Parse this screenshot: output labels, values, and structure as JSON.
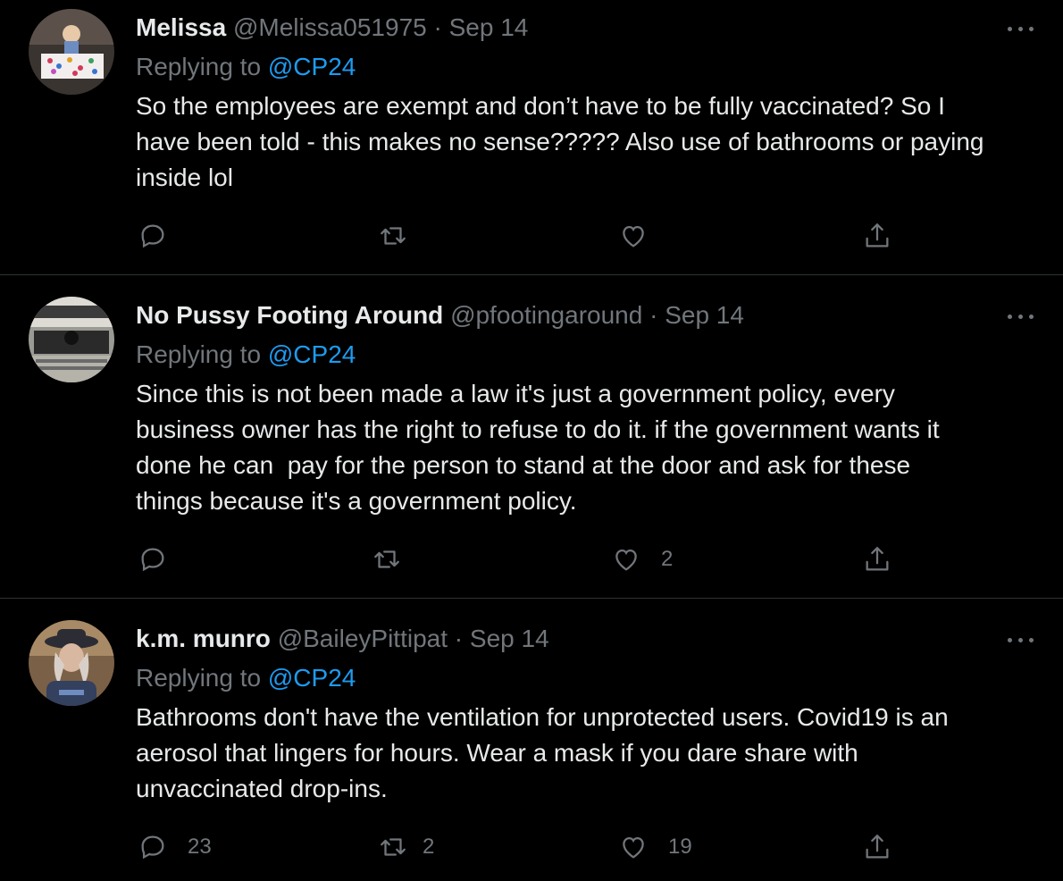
{
  "tweets": [
    {
      "name": "Melissa",
      "handle": "@Melissa051975",
      "dot": "·",
      "date": "Sep 14",
      "replying_prefix": "Replying to",
      "replying_handle": "@CP24",
      "text": "So the employees are exempt and don’t have to be fully vaccinated? So I\nhave been told - this makes no sense????? Also use of bathrooms or paying\ninside lol",
      "replies": "",
      "retweets": "",
      "likes": "",
      "icons": [
        "reply-icon",
        "retweet-icon",
        "like-icon",
        "share-icon"
      ]
    },
    {
      "name": "No Pussy Footing Around",
      "handle": "@pfootingaround",
      "dot": "·",
      "date": "Sep 14",
      "replying_prefix": "Replying to",
      "replying_handle": "@CP24",
      "text": "Since this is not been made a law it's just a government policy, every\nbusiness owner has the right to refuse to do it. if the government wants it\ndone he can  pay for the person to stand at the door and ask for these\nthings because it's a government policy.",
      "replies": "",
      "retweets": "",
      "likes": "2",
      "icons": [
        "reply-icon",
        "retweet-icon",
        "like-icon",
        "share-icon"
      ]
    },
    {
      "name": "k.m. munro",
      "handle": "@BaileyPittipat",
      "dot": "·",
      "date": "Sep 14",
      "replying_prefix": "Replying to",
      "replying_handle": "@CP24",
      "text": "Bathrooms don't have the ventilation for unprotected users. Covid19 is an\naerosol that lingers for hours. Wear a mask if you dare share with\nunvaccinated drop-ins.",
      "replies": "23",
      "retweets": "2",
      "likes": "19",
      "icons": [
        "reply-icon",
        "retweet-icon",
        "like-icon",
        "share-icon"
      ]
    }
  ],
  "colors": {
    "background": "#000000",
    "text": "#e7e9ea",
    "muted": "#71767b",
    "link": "#1d9bf0",
    "divider": "#2f3336"
  }
}
